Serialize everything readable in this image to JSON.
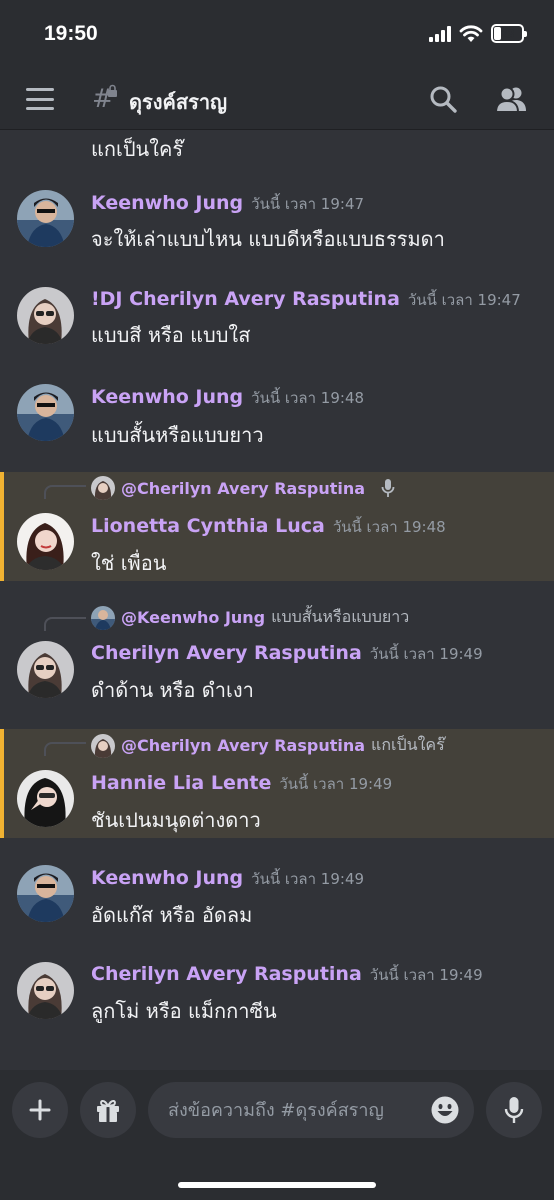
{
  "status_bar": {
    "time": "19:50",
    "battery": "23",
    "battery_level": 0.23
  },
  "header": {
    "channel_name": "ดุรงค์สราญ"
  },
  "messages": [
    {
      "content": "แกเป็นใคร๊"
    },
    {
      "author": "Keenwho Jung",
      "timestamp": "วันนี้ เวลา 19:47",
      "content": "จะให้เล่าแบบไหน แบบดีหรือแบบธรรมดา",
      "color": "#c9a3f5"
    },
    {
      "author": "!DJ Cherilyn Avery Rasputina",
      "timestamp": "วันนี้ เวลา 19:47",
      "content": "แบบสี หรือ แบบใส",
      "color": "#c9a3f5"
    },
    {
      "author": "Keenwho Jung",
      "timestamp": "วันนี้ เวลา 19:48",
      "content": "แบบสั้นหรือแบบยาว",
      "color": "#c9a3f5"
    },
    {
      "author": "Lionetta Cynthia Luca",
      "timestamp": "วันนี้ เวลา 19:48",
      "content": "ใช่ เพื่อน",
      "color": "#c9a3f5",
      "reply": {
        "name": "@Cherilyn Avery Rasputina",
        "text": ""
      }
    },
    {
      "author": "Cherilyn Avery Rasputina",
      "timestamp": "วันนี้ เวลา 19:49",
      "content": "ดำด้าน หรือ ดำเงา",
      "color": "#c9a3f5",
      "reply": {
        "name": "@Keenwho Jung",
        "text": "แบบสั้นหรือแบบยาว"
      }
    },
    {
      "author": "Hannie Lia Lente",
      "timestamp": "วันนี้ เวลา 19:49",
      "content": "ชันเปนมนุดต่างดาว",
      "color": "#c9a3f5",
      "reply": {
        "name": "@Cherilyn Avery Rasputina",
        "text": "แกเป็นใคร๊"
      }
    },
    {
      "author": "Keenwho Jung",
      "timestamp": "วันนี้ เวลา 19:49",
      "content": "อัดแก๊ส หรือ อัดลม",
      "color": "#c9a3f5"
    },
    {
      "author": "Cherilyn Avery Rasputina",
      "timestamp": "วันนี้ เวลา 19:49",
      "content": "ลูกโม่ หรือ แม็กกาซีน",
      "color": "#c9a3f5"
    }
  ],
  "composer": {
    "placeholder": "ส่งข้อความถึง #ดุรงค์สราญ"
  },
  "colors": {
    "background": "#313338",
    "bar": "#2b2d31",
    "accent_name": "#c9a3f5",
    "highlight_bg": "#44413a",
    "highlight_border": "#f0b232"
  }
}
